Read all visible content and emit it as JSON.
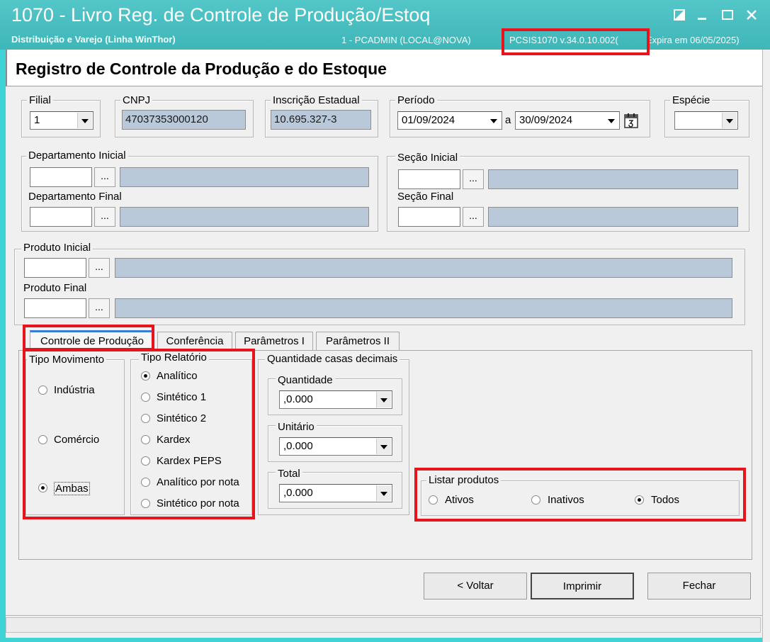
{
  "window": {
    "title": "1070 - Livro Reg. de Controle de Produção/Estoq",
    "subtitle": "Distribuição e Varejo (Linha WinThor)",
    "user": "1 - PCADMIN (LOCAL@NOVA)",
    "version": "PCSIS1070  v.34.0.10.002(",
    "expires": "Expira em 06/05/2025)"
  },
  "header": {
    "title": "Registro de Controle da Produção e do Estoque"
  },
  "filial": {
    "label": "Filial",
    "value": "1"
  },
  "cnpj": {
    "label": "CNPJ",
    "value": "47037353000120"
  },
  "ie": {
    "label": "Inscrição Estadual",
    "value": "10.695.327-3"
  },
  "periodo": {
    "label": "Período",
    "start": "01/09/2024",
    "sep": "a",
    "end": "30/09/2024"
  },
  "especie": {
    "label": "Espécie",
    "value": ""
  },
  "departamento": {
    "inicial_label": "Departamento Inicial",
    "final_label": "Departamento Final"
  },
  "secao": {
    "inicial_label": "Seção Inicial",
    "final_label": "Seção Final"
  },
  "produto": {
    "inicial_label": "Produto Inicial",
    "final_label": "Produto Final"
  },
  "lookup_button": "...",
  "tabs": [
    {
      "label": "Controle de Produção",
      "active": true
    },
    {
      "label": "Conferência"
    },
    {
      "label": "Parâmetros I"
    },
    {
      "label": "Parâmetros II"
    }
  ],
  "tipo_movimento": {
    "label": "Tipo Movimento",
    "options": [
      {
        "label": "Indústria",
        "selected": false
      },
      {
        "label": "Comércio",
        "selected": false
      },
      {
        "label": "Ambas",
        "selected": true
      }
    ]
  },
  "tipo_relatorio": {
    "label": "Tipo Relatório",
    "options": [
      {
        "label": "Analítico",
        "selected": true
      },
      {
        "label": "Sintético 1",
        "selected": false
      },
      {
        "label": "Sintético 2",
        "selected": false
      },
      {
        "label": "Kardex",
        "selected": false
      },
      {
        "label": "Kardex PEPS",
        "selected": false
      },
      {
        "label": "Analítico por nota",
        "selected": false
      },
      {
        "label": "Sintético por nota",
        "selected": false
      }
    ]
  },
  "casas_decimais": {
    "label": "Quantidade casas decimais",
    "quantidade": {
      "label": "Quantidade",
      "value": ",0.000"
    },
    "unitario": {
      "label": "Unitário",
      "value": ",0.000"
    },
    "total": {
      "label": "Total",
      "value": ",0.000"
    }
  },
  "listar_produtos": {
    "label": "Listar produtos",
    "options": [
      {
        "label": "Ativos",
        "selected": false
      },
      {
        "label": "Inativos",
        "selected": false
      },
      {
        "label": "Todos",
        "selected": true
      }
    ]
  },
  "buttons": {
    "voltar": "< Voltar",
    "imprimir": "Imprimir",
    "fechar": "Fechar"
  },
  "colors": {
    "titlebar": "#46bec1",
    "highlight": "#e8141c",
    "readonly_field": "#b9c9da",
    "active_tab_accent": "#3a7bd5"
  }
}
